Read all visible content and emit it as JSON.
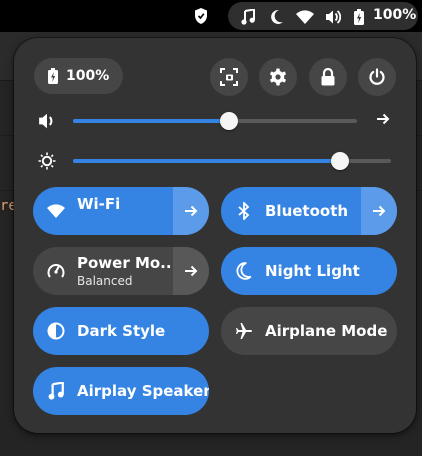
{
  "topbar": {
    "battery_percent": "100%",
    "icons": [
      "shield-icon",
      "music-note-icon",
      "moon-icon",
      "wifi-icon",
      "volume-icon",
      "battery-icon"
    ]
  },
  "background": {
    "partial_text": "res"
  },
  "quick_settings": {
    "battery_label": "100%",
    "actions": [
      "screenshot-icon",
      "gear-icon",
      "lock-icon",
      "power-icon"
    ],
    "volume_level": 0.55,
    "brightness_level": 0.84,
    "tiles": {
      "wifi": {
        "label": "Wi-Fi",
        "active": true
      },
      "bluetooth": {
        "label": "Bluetooth",
        "active": true
      },
      "power_mode": {
        "label": "Power Mo...",
        "subtitle": "Balanced",
        "active": false
      },
      "night_light": {
        "label": "Night Light",
        "active": true
      },
      "dark_style": {
        "label": "Dark Style",
        "active": true
      },
      "airplane_mode": {
        "label": "Airplane Mode",
        "active": false
      },
      "airplay_speakers": {
        "label": "Airplay Speakers",
        "active": true
      }
    }
  },
  "colors": {
    "accent": "#3584e4",
    "panel_bg": "#333333",
    "button_bg": "#464646"
  }
}
